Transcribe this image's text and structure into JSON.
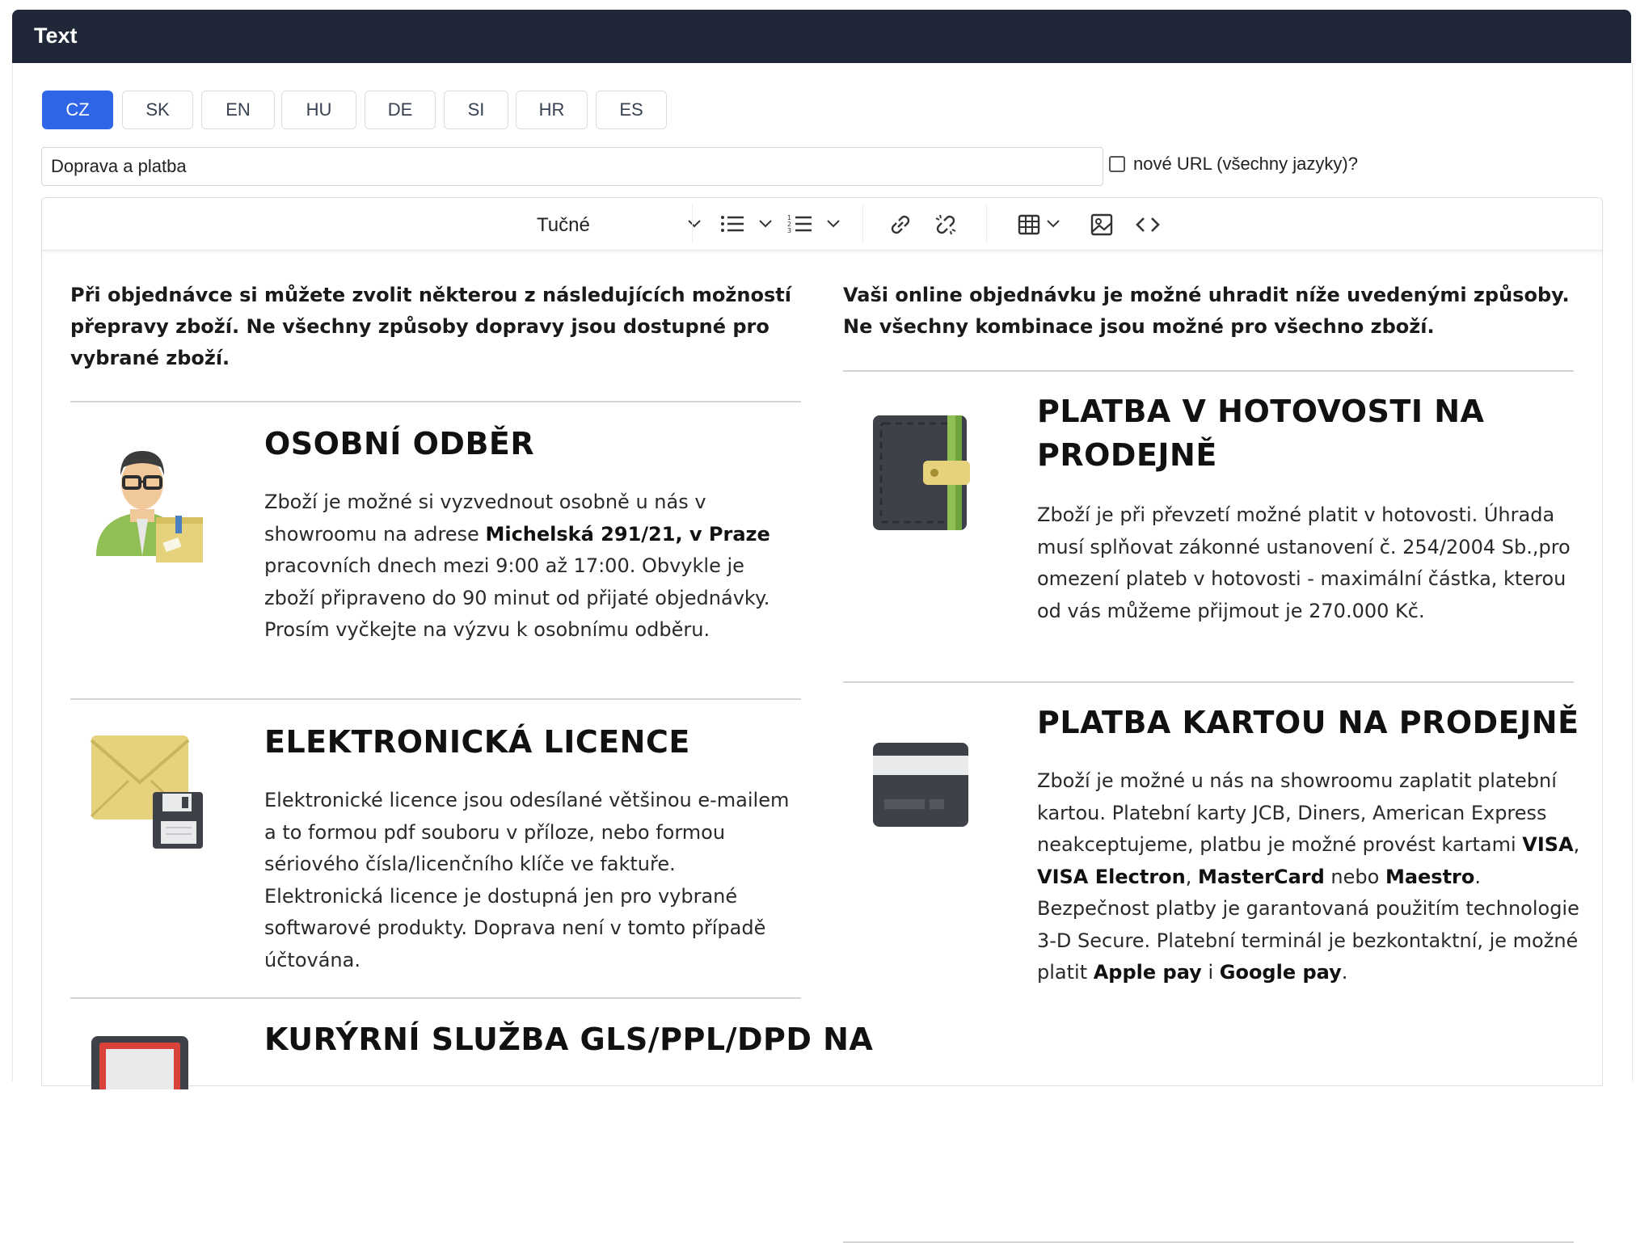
{
  "header": {
    "title": "Text"
  },
  "languages": [
    {
      "label": "CZ",
      "active": true
    },
    {
      "label": "SK",
      "active": false
    },
    {
      "label": "EN",
      "active": false
    },
    {
      "label": "HU",
      "active": false
    },
    {
      "label": "DE",
      "active": false
    },
    {
      "label": "SI",
      "active": false
    },
    {
      "label": "HR",
      "active": false
    },
    {
      "label": "ES",
      "active": false
    }
  ],
  "title_field": {
    "value": "Doprava a platba"
  },
  "url_checkbox": {
    "label": "nové URL (všechny jazyky)?",
    "checked": false
  },
  "toolbar": {
    "style_select": "Tučné",
    "icons": [
      "bullet-list-icon",
      "numbered-list-icon",
      "link-icon",
      "unlink-icon",
      "table-icon",
      "image-icon",
      "source-code-icon"
    ]
  },
  "content": {
    "left_intro": "Při objednávce si můžete zvolit některou z následujících možností přepravy zboží. Ne všechny způsoby dopravy jsou dostupné pro vybrané zboží.",
    "right_intro": "Vaši online objednávku je možné uhradit níže uvedenými způsoby. Ne všechny kombinace jsou možné pro všechno zboží.",
    "left_sections": [
      {
        "title": "OSOBNÍ ODBĚR",
        "icon": "person-with-package-icon",
        "body_parts": [
          "Zboží je možné si vyzvednout osobně u nás v showroomu na adrese ",
          "Michelská 291/21, v Praze",
          " pracovních dnech mezi 9:00 až 17:00. Obvykle je zboží připraveno do 90 minut od přijaté objednávky. Prosím vyčkejte na výzvu k osobnímu odběru."
        ]
      },
      {
        "title": "ELEKTRONICKÁ LICENCE",
        "icon": "envelope-with-floppy-icon",
        "body_parts": [
          "Elektronické licence jsou odesílané většinou e-mailem a to formou pdf souboru v příloze, nebo formou sériového čísla/licenčního klíče ve faktuře. Elektronická licence je dostupná jen pro vybrané softwarové produkty. Doprava není v tomto případě účtována."
        ]
      },
      {
        "title": "KURÝRNÍ SLUŽBA GLS/PPL/DPD NA",
        "icon": "courier-icon"
      }
    ],
    "right_sections": [
      {
        "title_lines": [
          "PLATBA V HOTOVOSTI NA",
          "PRODEJNĚ"
        ],
        "icon": "wallet-icon",
        "body_parts": [
          "Zboží je při převzetí možné platit v hotovosti. Úhrada musí splňovat zákonné ustanovení č. 254/2004 Sb.,pro omezení plateb v hotovosti - maximální částka, kterou od vás můžeme přijmout je 270.000 Kč."
        ]
      },
      {
        "title": "PLATBA KARTOU NA PRODEJNĚ",
        "icon": "credit-card-icon",
        "body_parts": [
          "Zboží je možné u nás na showroomu zaplatit platební kartou. Platební karty JCB, Diners, American Express neakceptujeme, platbu je možné provést kartami ",
          "VISA",
          ", ",
          "VISA Electron",
          ", ",
          "MasterCard",
          " nebo ",
          "Maestro",
          ". Bezpečnost platby je garantovaná použitím technologie 3-D Secure. Platební terminál je bezkontaktní, je možné platit ",
          "Apple pay",
          " i ",
          "Google pay",
          "."
        ]
      }
    ]
  },
  "colors": {
    "header_bg": "#1f2738",
    "active_tab": "#2f66e8"
  }
}
